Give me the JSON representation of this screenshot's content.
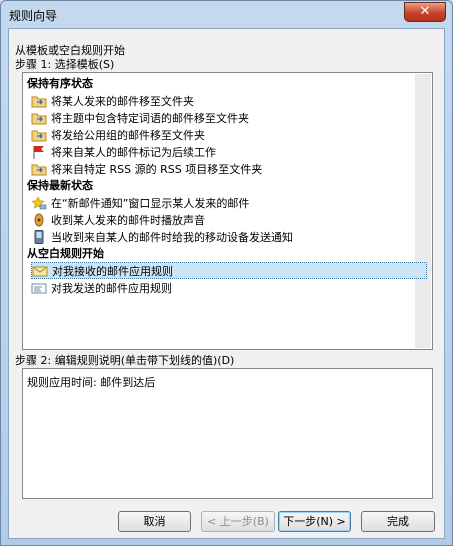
{
  "window": {
    "title": "规则向导",
    "close_glyph": "✕"
  },
  "step1": {
    "intro": "从模板或空白规则开始",
    "label": "步骤 1: 选择模板(S)",
    "sections": [
      {
        "title": "保持有序状态",
        "items": [
          {
            "label": "将某人发来的邮件移至文件夹",
            "icon": "folder-move-icon"
          },
          {
            "label": "将主题中包含特定词语的邮件移至文件夹",
            "icon": "folder-move-icon"
          },
          {
            "label": "将发给公用组的邮件移至文件夹",
            "icon": "folder-move-icon"
          },
          {
            "label": "将来自某人的邮件标记为后续工作",
            "icon": "red-flag-icon"
          },
          {
            "label": "将来自特定 RSS 源的 RSS 项目移至文件夹",
            "icon": "folder-move-icon"
          }
        ]
      },
      {
        "title": "保持最新状态",
        "items": [
          {
            "label": "在“新邮件通知”窗口显示某人发来的邮件",
            "icon": "star-notify-icon"
          },
          {
            "label": "收到某人发来的邮件时播放声音",
            "icon": "speaker-icon"
          },
          {
            "label": "当收到来自某人的邮件时给我的移动设备发送通知",
            "icon": "mobile-device-icon"
          }
        ]
      },
      {
        "title": "从空白规则开始",
        "items": [
          {
            "label": "对我接收的邮件应用规则",
            "icon": "envelope-icon",
            "selected": true
          },
          {
            "label": "对我发送的邮件应用规则",
            "icon": "sent-mail-icon"
          }
        ]
      }
    ]
  },
  "step2": {
    "label": "步骤 2: 编辑规则说明(单击带下划线的值)(D)",
    "description": "规则应用时间: 邮件到达后"
  },
  "buttons": {
    "cancel": "取消",
    "back": "< 上一步(B)",
    "next": "下一步(N) >",
    "finish": "完成"
  },
  "colors": {
    "selection": "#cde4f7",
    "focus_border": "#3c7fb1"
  }
}
